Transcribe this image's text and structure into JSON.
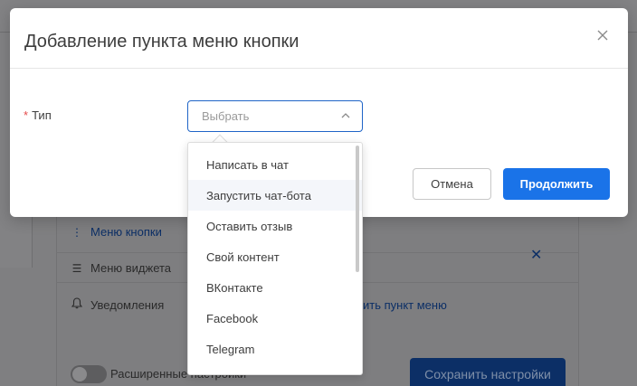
{
  "background": {
    "menu_items": [
      {
        "label": "Меню кнопки",
        "icon": "vertical-dots-icon",
        "active": true
      },
      {
        "label": "Меню виджета",
        "icon": "hamburger-icon",
        "active": false
      },
      {
        "label": "Уведомления",
        "icon": "bell-icon",
        "active": false
      }
    ],
    "add_link_partial": "ить пункт меню",
    "toggle_label": "Расширенные настройки",
    "save_button": "Сохранить настройки"
  },
  "modal": {
    "title": "Добавление пункта меню кнопки",
    "field": {
      "required_mark": "*",
      "label": "Тип",
      "placeholder": "Выбрать"
    },
    "options": [
      "Написать в чат",
      "Запустить чат-бота",
      "Оставить отзыв",
      "Свой контент",
      "ВКонтакте",
      "Facebook",
      "Telegram"
    ],
    "hovered_option": "Запустить чат-бота",
    "cancel_label": "Отмена",
    "continue_label": "Продолжить"
  },
  "colors": {
    "primary": "#1a73e8",
    "required": "#e54b4b",
    "overlay": "#7f7f81"
  }
}
